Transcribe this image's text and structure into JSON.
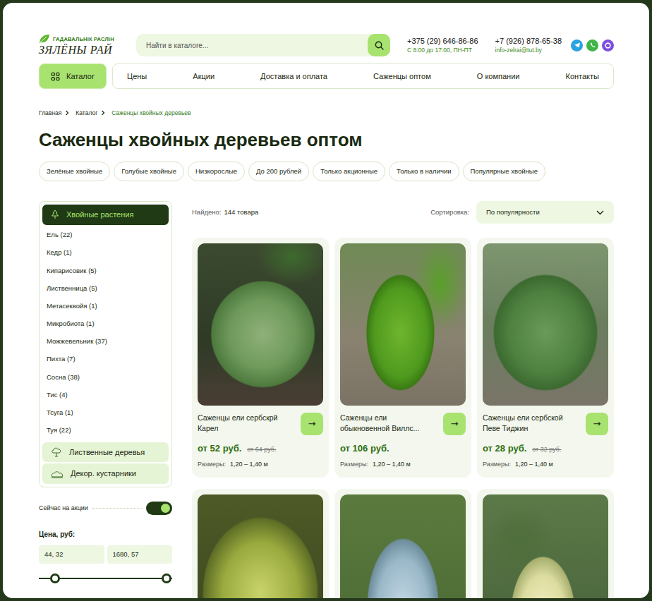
{
  "logo": {
    "tagline": "ГАДАВАЛЬНІК РАСЛІН",
    "name": "ЗЯЛЁНЫ РАЙ"
  },
  "search": {
    "placeholder": "Найти в каталоге..."
  },
  "contacts": [
    {
      "phone": "+375 (29) 646-86-86",
      "note": "С 8:00 до 17:00, ПН-ПТ"
    },
    {
      "phone": "+7 (926) 878-65-38",
      "note": "info-zelrai@tut.by"
    }
  ],
  "social": [
    {
      "kind": "telegram",
      "color": "#2aa3e0"
    },
    {
      "kind": "whatsapp",
      "color": "#3fb54a"
    },
    {
      "kind": "viber",
      "color": "#7d4ee0"
    }
  ],
  "nav": {
    "catalog": "Каталог",
    "items": [
      "Цены",
      "Акции",
      "Доставка и оплата",
      "Саженцы оптом",
      "О компании",
      "Контакты"
    ]
  },
  "breadcrumbs": [
    {
      "label": "Главная",
      "selected": false
    },
    {
      "label": "Каталог",
      "selected": false
    },
    {
      "label": "Саженцы хвойных деревьев",
      "selected": true
    }
  ],
  "title": "Саженцы хвойных деревьев оптом",
  "chips": [
    "Зелёные хвойные",
    "Голубые хвойные",
    "Низкорослые",
    "До 200 рублей",
    "Только акционные",
    "Только в наличии",
    "Популярные хвойные"
  ],
  "sidebar": {
    "groups": [
      {
        "label": "Хвойные растения",
        "selected": true,
        "expanded": true,
        "items": [
          "Ель (22)",
          "Кедр (1)",
          "Кипарисовик (5)",
          "Лиственница (5)",
          "Метасеквойя (1)",
          "Микробиота (1)",
          "Можжевельник (37)",
          "Пихта (7)",
          "Сосна (38)",
          "Тис (4)",
          "Тсуга (1)",
          "Туя (22)"
        ]
      },
      {
        "label": "Лиственные деревья",
        "selected": false,
        "expanded": false,
        "items": []
      },
      {
        "label": "Декор. кустарники",
        "selected": false,
        "expanded": false,
        "items": []
      }
    ]
  },
  "filters": {
    "sale": {
      "label": "Сейчас на акции",
      "on": true
    },
    "price": {
      "label": "Цена, руб:",
      "min": "44, 32",
      "max": "1680, 57",
      "low": 0.12,
      "high": 0.96
    }
  },
  "results": {
    "found_label": "Найдено:",
    "found": "144 товара",
    "sort_label": "Сортировка:",
    "sort": "По популярности"
  },
  "products": [
    {
      "kind": "full",
      "title": "Саженцы ели сербскрй Карел",
      "arrow": "→",
      "price": "от 52 руб.",
      "old_price": "от 64 руб.",
      "size_label": "Размеры:",
      "size": "1,20 – 1,40 м"
    },
    {
      "kind": "full",
      "title": "Саженцы ели обыкновенной Виллс...",
      "arrow": "→",
      "price": "от 106 руб.",
      "old_price": "",
      "size_label": "Размеры:",
      "size": "1,20 – 1,40 м"
    },
    {
      "kind": "full",
      "title": "Саженцы ели сербской Певе Тиджин",
      "arrow": "→",
      "price": "от 28 руб.",
      "old_price": "от 32 руб.",
      "size_label": "Размеры:",
      "size": "1,20 – 1,40 м"
    },
    {
      "kind": "photo-only"
    },
    {
      "kind": "photo-only"
    },
    {
      "kind": "photo-only"
    }
  ]
}
